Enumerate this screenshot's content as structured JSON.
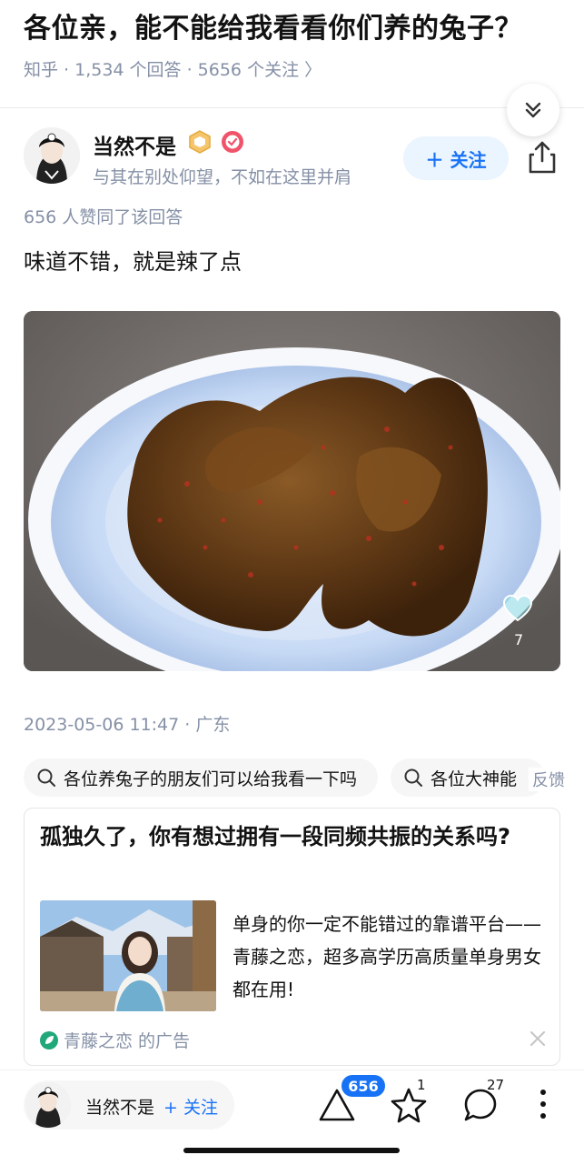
{
  "question": {
    "title": "各位亲，能不能给我看看你们养的兔子？",
    "meta": "知乎 · 1,534 个回答 · 5656 个关注 〉"
  },
  "author": {
    "name": "当然不是",
    "bio": "与其在别处仰望，不如在这里并肩",
    "follow_label": "＋ 关注"
  },
  "answer": {
    "vote_summary": "656 人赞同了该回答",
    "text": "味道不错，就是辣了点",
    "image_like_count": "7",
    "timestamp": "2023-05-06 11:47 · 广东"
  },
  "related_searches": [
    "各位养兔子的朋友们可以给我看一下吗",
    "各位大神能"
  ],
  "feedback_label": "反馈",
  "ad": {
    "title": "孤独久了，你有想过拥有一段同频共振的关系吗?",
    "description": "单身的你一定不能错过的靠谱平台——青藤之恋，超多高学历高质量单身男女都在用!",
    "source": "青藤之恋 的广告"
  },
  "bottom_bar": {
    "author_name": "当然不是",
    "follow_label": "+ 关注",
    "upvote_count": "656",
    "favorite_count": "1",
    "comment_count": "27"
  },
  "colors": {
    "accent": "#1772f6",
    "meta_text": "#8590a6",
    "follow_bg": "#ebf5ff",
    "ad_icon": "#21a87a"
  }
}
